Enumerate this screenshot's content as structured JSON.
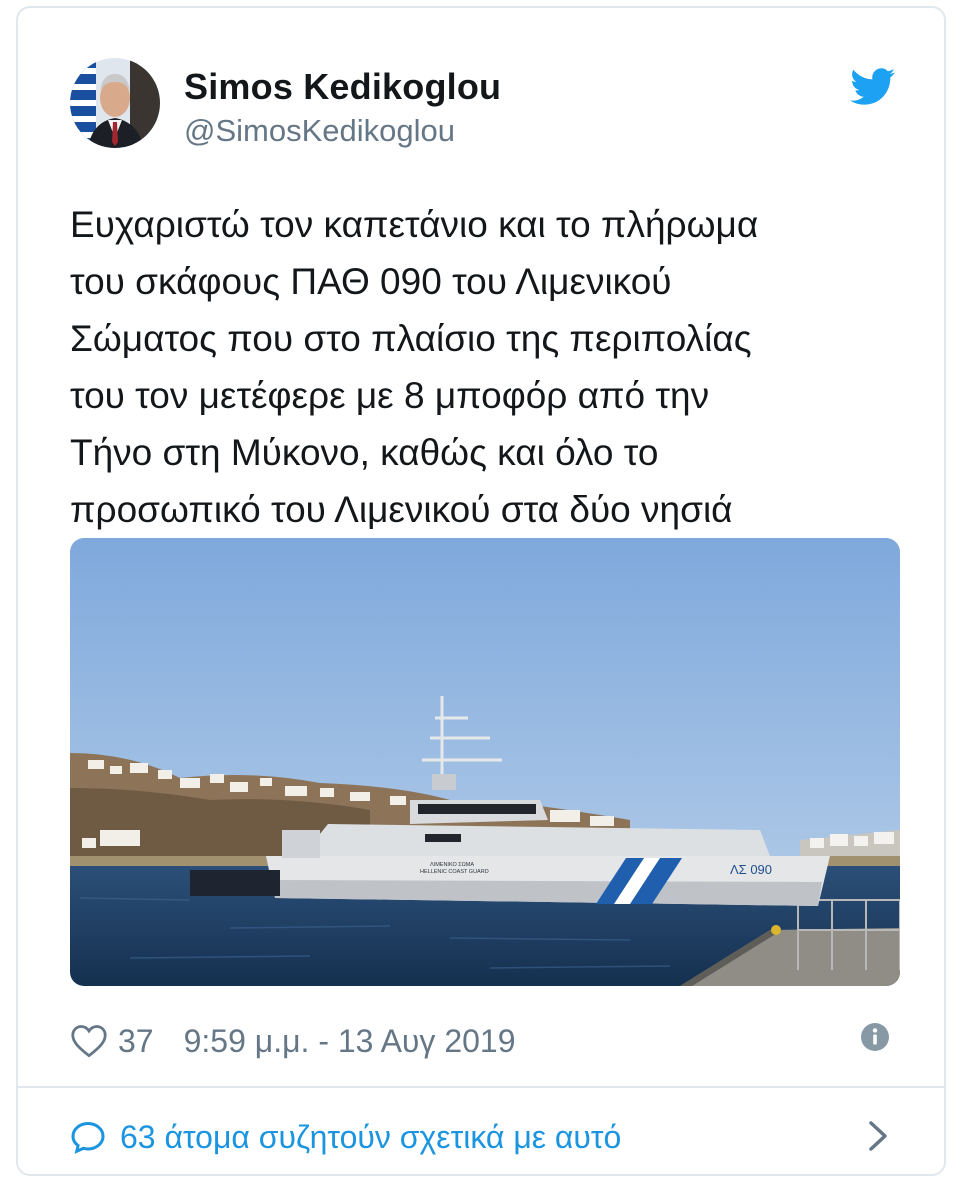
{
  "author": {
    "name": "Simos Kedikoglou",
    "handle": "@SimosKedikoglou"
  },
  "tweet": {
    "lines": [
      "Ευχαριστώ τον καπετάνιο και το πλήρωμα",
      "του σκάφους ΠΑΘ 090 του Λιμενικού",
      "Σώματος που στο πλαίσιο της περιπολίας",
      "του τον μετέφερε με 8 μποφόρ από την",
      "Τήνο στη Μύκονο, καθώς και όλο το",
      "προσωπικό του Λιμενικού στα δύο νησιά"
    ]
  },
  "media": {
    "ship_hull_marking": "ΛΣ 090",
    "ship_side_text_1": "ΛΙΜΕΝΙΚΟ ΣΩΜΑ",
    "ship_side_text_2": "HELLENIC COAST GUARD"
  },
  "meta": {
    "likes": "37",
    "timestamp": "9:59 μ.μ. - 13 Αυγ 2019"
  },
  "conversation": {
    "label": "63 άτομα συζητούν σχετικά με αυτό"
  },
  "icons": {
    "twitter": "twitter-bird-icon",
    "like": "heart-icon",
    "info": "info-icon",
    "conversation": "speech-bubble-icon",
    "chevron": "chevron-right-icon"
  },
  "colors": {
    "brand_blue": "#1da1f2",
    "link_blue": "#1b95e0",
    "secondary_text": "#657786",
    "border": "#e1e8ed"
  }
}
